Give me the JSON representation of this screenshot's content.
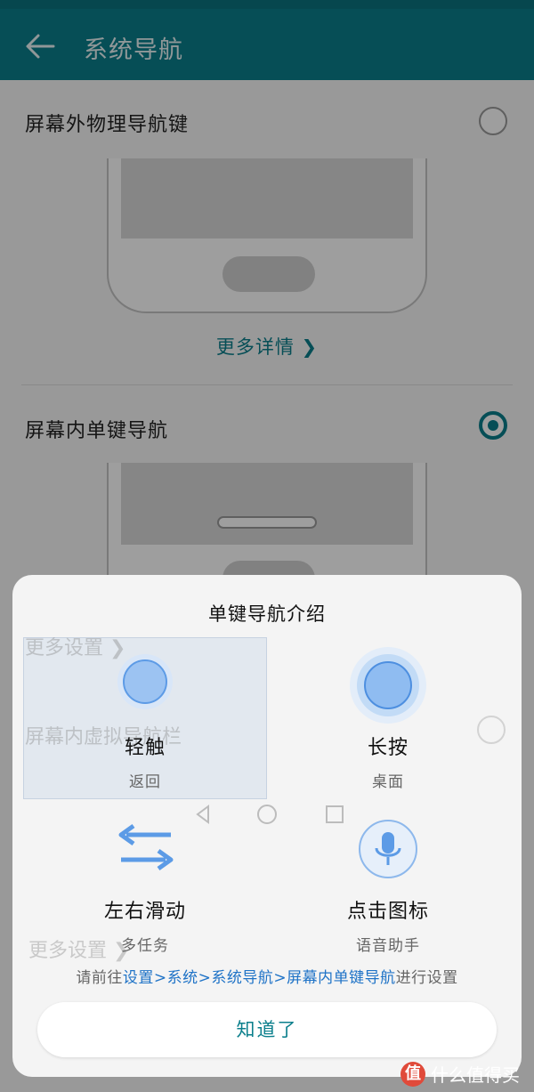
{
  "header": {
    "title": "系统导航",
    "colors": {
      "bar": "#0b7f8c"
    }
  },
  "options": [
    {
      "label": "屏幕外物理导航键",
      "selected": false,
      "link": "更多详情 ❯"
    },
    {
      "label": "屏幕内单键导航",
      "selected": true,
      "link": "更多设置 ❯"
    },
    {
      "label": "屏幕内虚拟导航栏",
      "selected": false,
      "link": "更多设置 ❯"
    }
  ],
  "dialog": {
    "title": "单键导航介绍",
    "gestures": [
      {
        "label": "轻触",
        "sub": "返回",
        "icon": "tap-circle-icon"
      },
      {
        "label": "长按",
        "sub": "桌面",
        "icon": "long-press-circle-icon"
      },
      {
        "label": "左右滑动",
        "sub": "多任务",
        "icon": "swap-arrows-icon"
      },
      {
        "label": "点击图标",
        "sub": "语音助手",
        "icon": "microphone-icon"
      }
    ],
    "note": {
      "prefix": "请前往",
      "path": "设置>系统>系统导航>屏幕内单键导航",
      "suffix": "进行设置"
    },
    "ok_label": "知道了"
  },
  "watermark": {
    "text": "什么值得买",
    "badge": "值"
  },
  "colors": {
    "accent": "#0b7f8c",
    "link": "#1f73c7",
    "icon_blue": "#4d97e8"
  }
}
